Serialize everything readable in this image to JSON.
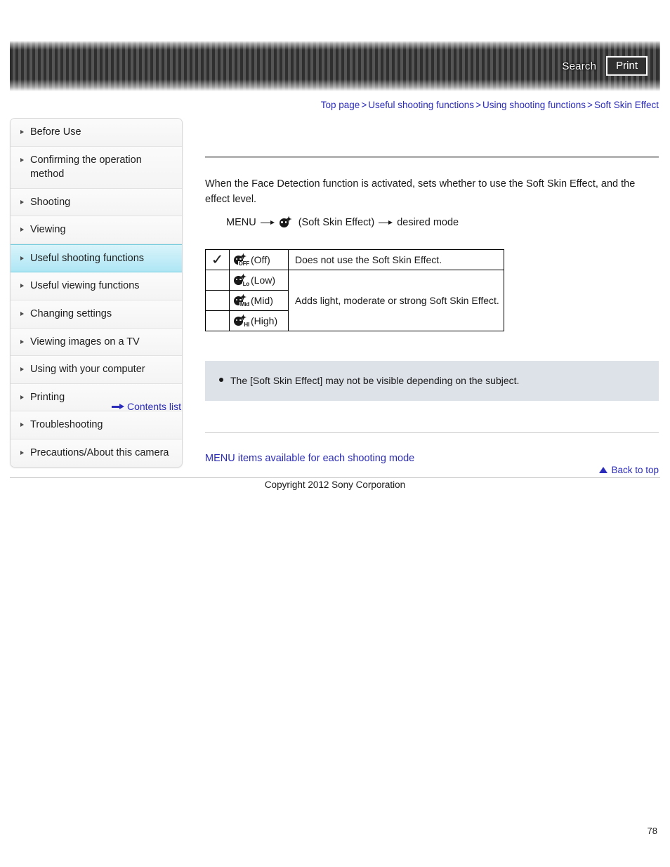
{
  "header": {
    "search_label": "Search",
    "print_label": "Print"
  },
  "breadcrumb": {
    "items": [
      {
        "label": "Top page"
      },
      {
        "label": "Useful shooting functions"
      },
      {
        "label": "Using shooting functions"
      },
      {
        "label": "Soft Skin Effect"
      }
    ],
    "separator": ">"
  },
  "sidebar": {
    "items": [
      {
        "label": "Before Use",
        "active": false
      },
      {
        "label": "Confirming the operation method",
        "active": false
      },
      {
        "label": "Shooting",
        "active": false
      },
      {
        "label": "Viewing",
        "active": false
      },
      {
        "label": "Useful shooting functions",
        "active": true
      },
      {
        "label": "Useful viewing functions",
        "active": false
      },
      {
        "label": "Changing settings",
        "active": false
      },
      {
        "label": "Viewing images on a TV",
        "active": false
      },
      {
        "label": "Using with your computer",
        "active": false
      },
      {
        "label": "Printing",
        "active": false
      },
      {
        "label": "Troubleshooting",
        "active": false
      },
      {
        "label": "Precautions/About this camera",
        "active": false
      }
    ],
    "contents_link": "Contents list"
  },
  "main": {
    "intro": "When the Face Detection function is activated, sets whether to use the Soft Skin Effect, and the effect level.",
    "menu_path": {
      "menu_label": "MENU",
      "icon_sub": "",
      "icon_label": "(Soft Skin Effect)",
      "end_label": "desired mode"
    },
    "table": {
      "rows": [
        {
          "checked": "✓",
          "icon_sub": "OFF",
          "mode_label": "(Off)",
          "description": "Does not use the Soft Skin Effect."
        },
        {
          "checked": "",
          "icon_sub": "Lo",
          "mode_label": "(Low)",
          "description": "Adds light, moderate or strong Soft Skin Effect."
        },
        {
          "checked": "",
          "icon_sub": "Mid",
          "mode_label": "(Mid)",
          "description": ""
        },
        {
          "checked": "",
          "icon_sub": "HI",
          "mode_label": "(High)",
          "description": ""
        }
      ]
    },
    "note": "The [Soft Skin Effect] may not be visible depending on the subject.",
    "related_link": "MENU items available for each shooting mode"
  },
  "footer": {
    "back_to_top": "Back to top",
    "copyright": "Copyright 2012 Sony Corporation",
    "page_number": "78"
  },
  "colors": {
    "link": "#2b2bbb",
    "active_nav": "#aee6f4",
    "note_bg": "#dde2e8"
  }
}
